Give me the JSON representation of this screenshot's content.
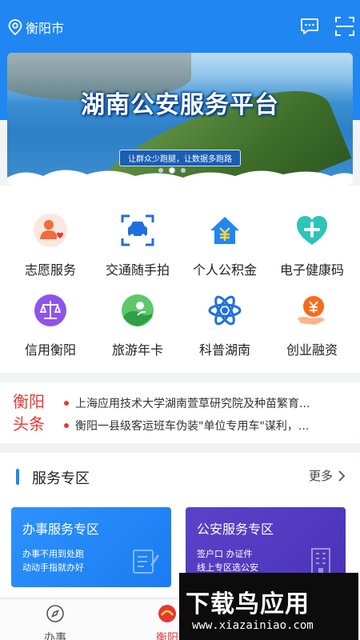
{
  "header": {
    "city": "衡阳市"
  },
  "banner": {
    "title": "湖南公安服务平台",
    "slogan": "让群众少跑腿，让数据多跑路",
    "page_count": 3,
    "active_page": 2
  },
  "services": [
    {
      "label": "志愿服务",
      "icon": "volunteer-icon"
    },
    {
      "label": "交通随手拍",
      "icon": "traffic-camera-icon"
    },
    {
      "label": "个人公积金",
      "icon": "housing-fund-icon"
    },
    {
      "label": "电子健康码",
      "icon": "health-code-icon"
    },
    {
      "label": "信用衡阳",
      "icon": "credit-scale-icon"
    },
    {
      "label": "旅游年卡",
      "icon": "travel-card-icon"
    },
    {
      "label": "科普湖南",
      "icon": "science-atom-icon"
    },
    {
      "label": "创业融资",
      "icon": "finance-coin-icon"
    }
  ],
  "news": {
    "brand_line1": "衡阳",
    "brand_line2": "头条",
    "items": [
      "上海应用技术大学湖南萱草研究院及种苗繁育...",
      "衡阳一县级客运班车伪装\"单位专用车\"谋利，..."
    ]
  },
  "service_zone": {
    "title": "服务专区",
    "more": "更多",
    "cards": [
      {
        "title": "办事服务专区",
        "line1": "办事不用到处跑",
        "line2": "动动手指就办好"
      },
      {
        "title": "公安服务专区",
        "line1": "签户口 办证件",
        "line2": "线上专区选公安"
      }
    ]
  },
  "tabbar": {
    "tabs": [
      {
        "label": "办事"
      },
      {
        "label": "衡阳"
      }
    ]
  },
  "watermark": {
    "brand": "下载鸟应用",
    "url": "www.xiazainiao.com"
  },
  "colors": {
    "primary": "#1f86f2",
    "accent_red": "#e53935",
    "card_blue": "#1a7cf0",
    "card_purple": "#4a33b8"
  }
}
